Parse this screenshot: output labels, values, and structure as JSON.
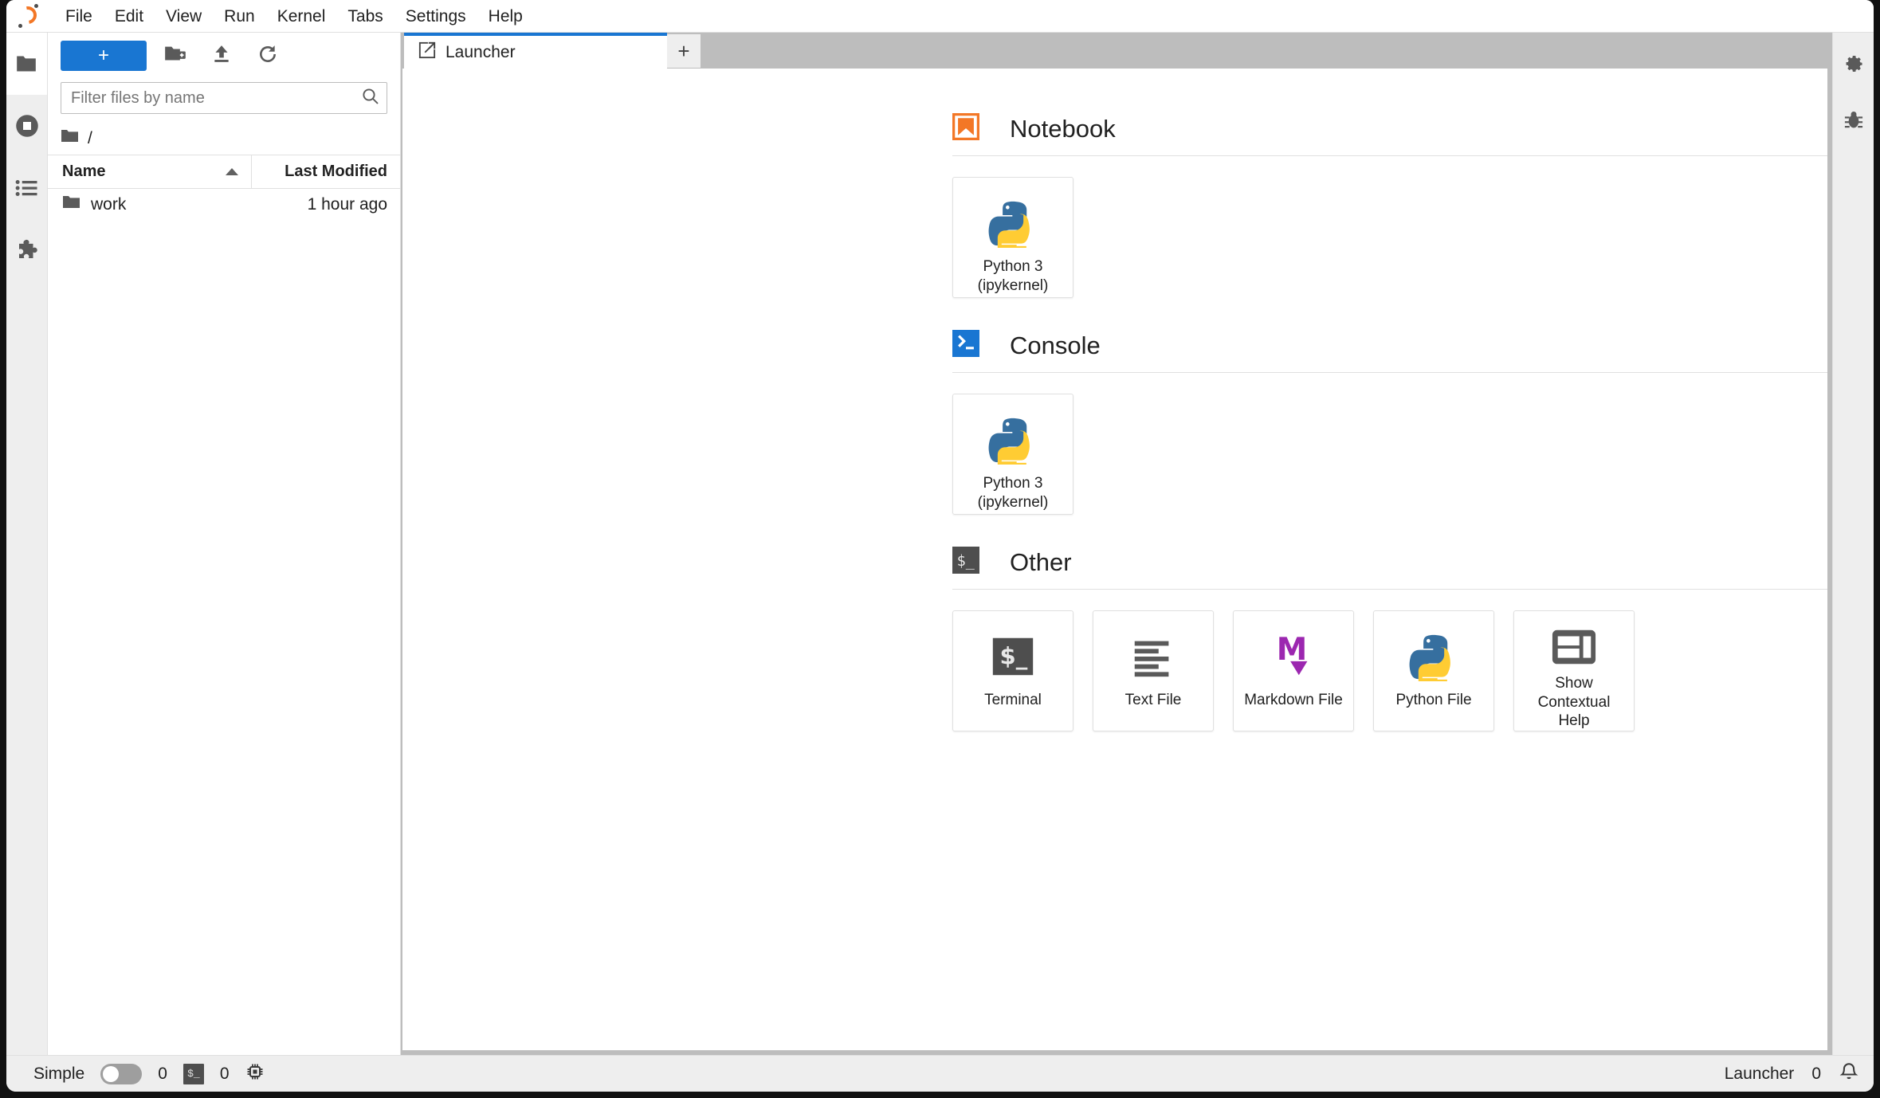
{
  "app": {
    "title": "JupyterLab",
    "logo_icon": "jupyter-logo"
  },
  "menubar": {
    "items": [
      {
        "label": "File"
      },
      {
        "label": "Edit"
      },
      {
        "label": "View"
      },
      {
        "label": "Run"
      },
      {
        "label": "Kernel"
      },
      {
        "label": "Tabs"
      },
      {
        "label": "Settings"
      },
      {
        "label": "Help"
      }
    ]
  },
  "left_rail": {
    "items": [
      {
        "name": "file-browser",
        "icon": "folder-icon",
        "active": true
      },
      {
        "name": "running-terminals-kernels",
        "icon": "stop-circle-icon",
        "active": false
      },
      {
        "name": "commands",
        "icon": "list-icon",
        "active": false
      },
      {
        "name": "extension-manager",
        "icon": "puzzle-piece-icon",
        "active": false
      }
    ]
  },
  "right_rail": {
    "items": [
      {
        "name": "property-inspector",
        "icon": "gear-icon"
      },
      {
        "name": "debugger",
        "icon": "bug-icon"
      }
    ]
  },
  "file_browser": {
    "toolbar": {
      "new_label": "+",
      "new_folder_icon": "new-folder-icon",
      "upload_icon": "upload-icon",
      "refresh_icon": "refresh-icon"
    },
    "filter": {
      "placeholder": "Filter files by name",
      "value": "",
      "icon": "search-icon"
    },
    "breadcrumb": {
      "icon": "folder-icon",
      "path": "/"
    },
    "columns": {
      "name": "Name",
      "last_modified": "Last Modified",
      "sort": "ascending"
    },
    "rows": [
      {
        "icon": "folder-icon",
        "name": "work",
        "last_modified": "1 hour ago"
      }
    ]
  },
  "dock": {
    "tabs": [
      {
        "label": "Launcher",
        "icon": "launcher-icon",
        "active": true
      }
    ],
    "add_tab_label": "+"
  },
  "launcher": {
    "sections": [
      {
        "title": "Notebook",
        "icon": "notebook-icon",
        "cards": [
          {
            "label": "Python 3\n(ipykernel)",
            "icon": "python-icon"
          }
        ]
      },
      {
        "title": "Console",
        "icon": "console-icon",
        "cards": [
          {
            "label": "Python 3\n(ipykernel)",
            "icon": "python-icon"
          }
        ]
      },
      {
        "title": "Other",
        "icon": "terminal-icon",
        "cards": [
          {
            "label": "Terminal",
            "icon": "terminal-icon"
          },
          {
            "label": "Text File",
            "icon": "text-file-icon"
          },
          {
            "label": "Markdown File",
            "icon": "markdown-icon"
          },
          {
            "label": "Python File",
            "icon": "python-icon"
          },
          {
            "label": "Show\nContextual\nHelp",
            "icon": "inspector-icon"
          }
        ]
      }
    ]
  },
  "statusbar": {
    "simple_label": "Simple",
    "simple_on": false,
    "kernel_count": "0",
    "terminal_icon": "terminal-badge-icon",
    "terminal_count": "0",
    "kernel_icon": "cpu-icon",
    "current_tab": "Launcher",
    "notification_count": "0",
    "notification_icon": "bell-icon"
  },
  "colors": {
    "accent": "#1976d2",
    "notebook_orange": "#f37726",
    "markdown_purple": "#9c27b0",
    "terminal_dark": "#4e4e4e",
    "rail_bg": "#eeeeee",
    "dock_bg": "#bdbdbd"
  }
}
